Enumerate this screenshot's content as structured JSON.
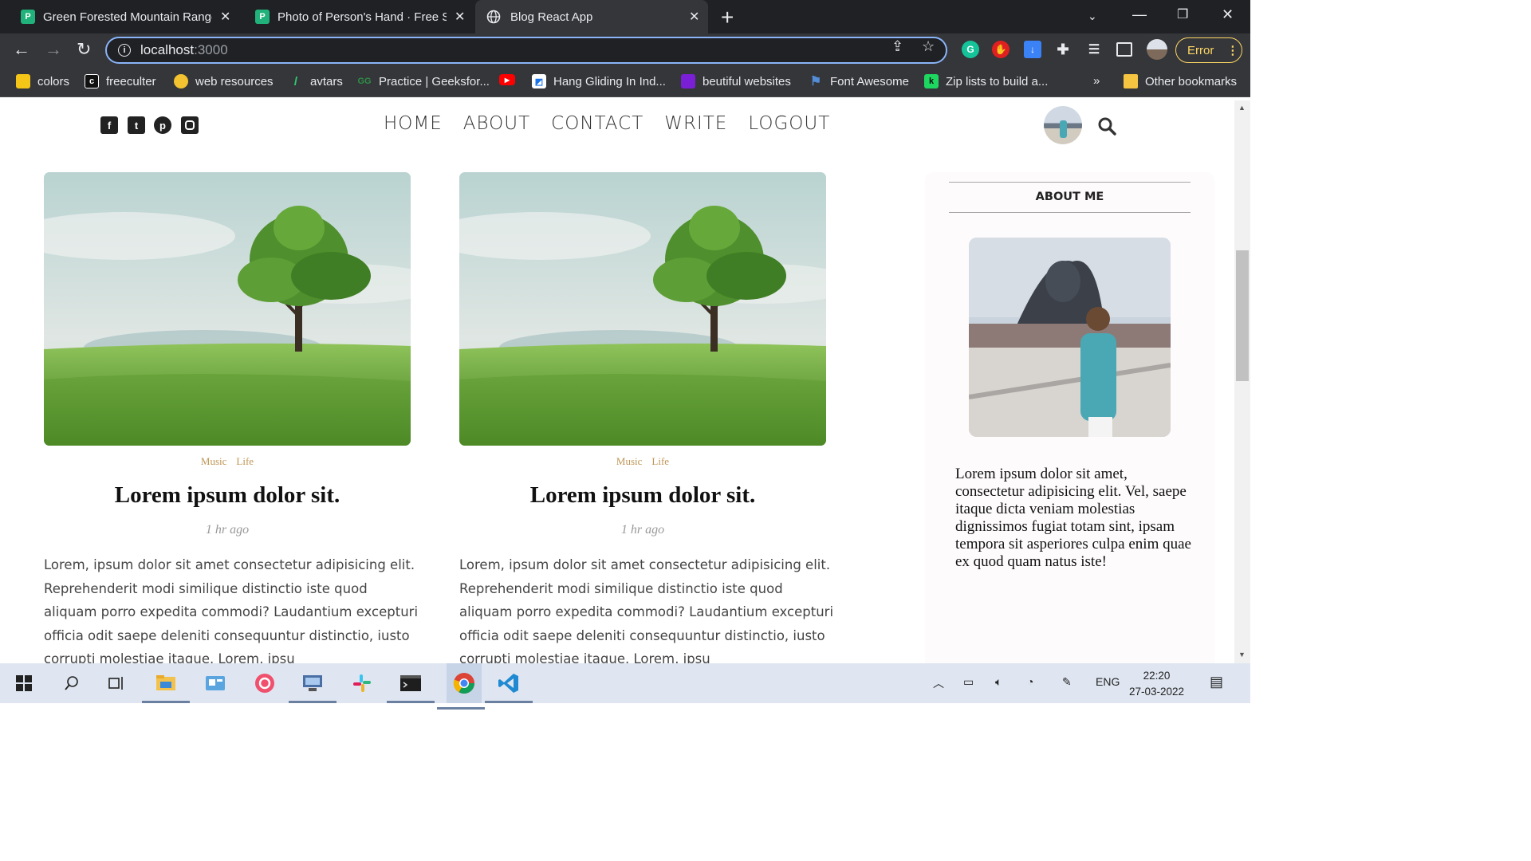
{
  "browser": {
    "tabs": [
      {
        "title": "Green Forested Mountain Range",
        "favicon": "P",
        "active": false
      },
      {
        "title": "Photo of Person's Hand · Free Stock",
        "favicon": "P",
        "active": false
      },
      {
        "title": "Blog React App",
        "favicon": "globe",
        "active": true
      }
    ],
    "url_host": "localhost",
    "url_port": ":3000",
    "error_label": "Error",
    "bookmarks": [
      {
        "label": "colors",
        "color": "#f5c518"
      },
      {
        "label": "freeculter",
        "color": "#111111"
      },
      {
        "label": "web resources",
        "color": "#f2c230"
      },
      {
        "label": "avtars",
        "color": "#2ecc71"
      },
      {
        "label": "Practice | Geeksfor...",
        "color": "#2f8d46"
      },
      {
        "label": "",
        "color": "#ff0000"
      },
      {
        "label": "Hang Gliding In Ind...",
        "color": "#ffffff"
      },
      {
        "label": "beutiful websites",
        "color": "#7a1fd6"
      },
      {
        "label": "Font Awesome",
        "color": "#538dd7"
      },
      {
        "label": "Zip lists to build a...",
        "color": "#1ed760"
      }
    ],
    "more_bookmarks": "»",
    "other_bookmarks": "Other bookmarks"
  },
  "blog": {
    "menu": [
      "HOME",
      "ABOUT",
      "CONTACT",
      "WRITE",
      "LOGOUT"
    ],
    "posts": [
      {
        "categories": [
          "Music",
          "Life"
        ],
        "title": "Lorem ipsum dolor sit.",
        "date": "1 hr ago",
        "desc": "Lorem, ipsum dolor sit amet consectetur adipisicing elit. Reprehenderit modi similique distinctio iste quod aliquam porro expedita commodi? Laudantium excepturi officia odit saepe deleniti consequuntur distinctio, iusto corrupti molestiae itaque. Lorem, ipsu"
      },
      {
        "categories": [
          "Music",
          "Life"
        ],
        "title": "Lorem ipsum dolor sit.",
        "date": "1 hr ago",
        "desc": "Lorem, ipsum dolor sit amet consectetur adipisicing elit. Reprehenderit modi similique distinctio iste quod aliquam porro expedita commodi? Laudantium excepturi officia odit saepe deleniti consequuntur distinctio, iusto corrupti molestiae itaque. Lorem, ipsu"
      }
    ],
    "sidebar": {
      "title": "ABOUT ME",
      "text": "Lorem ipsum dolor sit amet, consectetur adipisicing elit. Vel, saepe itaque dicta veniam molestias dignissimos fugiat totam sint, ipsam tempora sit asperiores culpa enim quae ex quod quam natus iste!"
    }
  },
  "taskbar": {
    "lang": "ENG",
    "time": "22:20",
    "date": "27-03-2022"
  },
  "colors": {
    "accent": "#8ab4f8",
    "category": "#be9656",
    "error": "#fdd663"
  }
}
